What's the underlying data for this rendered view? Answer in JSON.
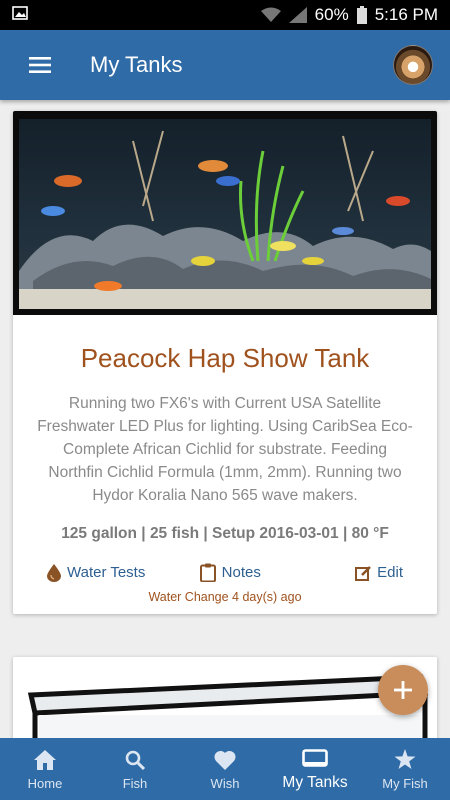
{
  "status_bar": {
    "battery": "60%",
    "time": "5:16 PM"
  },
  "app_bar": {
    "title": "My Tanks"
  },
  "tanks": [
    {
      "name": "Peacock Hap Show Tank",
      "description": "Running two FX6's with Current USA Satellite Freshwater LED Plus for lighting. Using CaribSea Eco-Complete African Cichlid for substrate. Feeding Northfin Cichlid Formula (1mm, 2mm). Running two Hydor Koralia Nano 565 wave makers.",
      "stats": "125 gallon | 25 fish | Setup 2016-03-01 | 80 °F",
      "actions": {
        "water_tests": "Water Tests",
        "notes": "Notes",
        "edit": "Edit"
      },
      "water_change": "Water Change 4 day(s) ago"
    }
  ],
  "bottom_nav": [
    {
      "label": "Home",
      "icon": "home-icon"
    },
    {
      "label": "Fish",
      "icon": "search-icon"
    },
    {
      "label": "Wish",
      "icon": "heart-icon"
    },
    {
      "label": "My Tanks",
      "icon": "tank-icon",
      "active": true
    },
    {
      "label": "My Fish",
      "icon": "star-icon"
    }
  ],
  "colors": {
    "primary": "#2f6ba6",
    "accent": "#a0521e",
    "fab": "#c98d5b",
    "link": "#2d5f91"
  }
}
